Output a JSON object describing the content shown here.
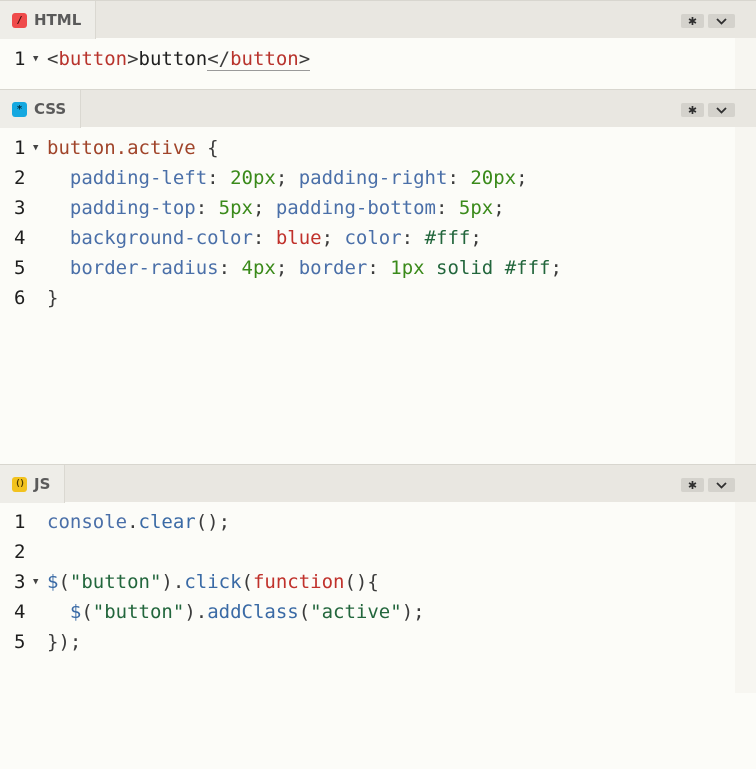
{
  "panes": {
    "html": {
      "label": "HTML",
      "icon": "html-slash-icon",
      "lines": [
        {
          "n": "1",
          "fold": true,
          "tokens": [
            {
              "t": "<",
              "c": "punc"
            },
            {
              "t": "button",
              "c": "tag"
            },
            {
              "t": ">",
              "c": "punc"
            },
            {
              "t": "button",
              "c": "text"
            },
            {
              "t": "</",
              "c": "punc",
              "u": true
            },
            {
              "t": "button",
              "c": "tag",
              "u": true
            },
            {
              "t": ">",
              "c": "punc",
              "u": true
            }
          ]
        }
      ]
    },
    "css": {
      "label": "CSS",
      "icon": "css-asterisk-icon",
      "lines": [
        {
          "n": "1",
          "fold": true,
          "tokens": [
            {
              "t": "button.active",
              "c": "sel"
            },
            {
              "t": " {",
              "c": "punc"
            }
          ]
        },
        {
          "n": "2",
          "tokens": [
            {
              "t": "  ",
              "c": "punc"
            },
            {
              "t": "padding-left",
              "c": "prop"
            },
            {
              "t": ": ",
              "c": "punc"
            },
            {
              "t": "20px",
              "c": "num"
            },
            {
              "t": "; ",
              "c": "punc"
            },
            {
              "t": "padding-right",
              "c": "prop"
            },
            {
              "t": ": ",
              "c": "punc"
            },
            {
              "t": "20px",
              "c": "num"
            },
            {
              "t": ";",
              "c": "punc"
            }
          ]
        },
        {
          "n": "3",
          "tokens": [
            {
              "t": "  ",
              "c": "punc"
            },
            {
              "t": "padding-top",
              "c": "prop"
            },
            {
              "t": ": ",
              "c": "punc"
            },
            {
              "t": "5px",
              "c": "num"
            },
            {
              "t": "; ",
              "c": "punc"
            },
            {
              "t": "padding-bottom",
              "c": "prop"
            },
            {
              "t": ": ",
              "c": "punc"
            },
            {
              "t": "5px",
              "c": "num"
            },
            {
              "t": ";",
              "c": "punc"
            }
          ]
        },
        {
          "n": "4",
          "tokens": [
            {
              "t": "  ",
              "c": "punc"
            },
            {
              "t": "background-color",
              "c": "prop"
            },
            {
              "t": ": ",
              "c": "punc"
            },
            {
              "t": "blue",
              "c": "kw"
            },
            {
              "t": "; ",
              "c": "punc"
            },
            {
              "t": "color",
              "c": "prop"
            },
            {
              "t": ": ",
              "c": "punc"
            },
            {
              "t": "#fff",
              "c": "val"
            },
            {
              "t": ";",
              "c": "punc"
            }
          ]
        },
        {
          "n": "5",
          "tokens": [
            {
              "t": "  ",
              "c": "punc"
            },
            {
              "t": "border-radius",
              "c": "prop"
            },
            {
              "t": ": ",
              "c": "punc"
            },
            {
              "t": "4px",
              "c": "num"
            },
            {
              "t": "; ",
              "c": "punc"
            },
            {
              "t": "border",
              "c": "prop"
            },
            {
              "t": ": ",
              "c": "punc"
            },
            {
              "t": "1px",
              "c": "num"
            },
            {
              "t": " ",
              "c": "punc"
            },
            {
              "t": "solid",
              "c": "val"
            },
            {
              "t": " ",
              "c": "punc"
            },
            {
              "t": "#fff",
              "c": "val"
            },
            {
              "t": ";",
              "c": "punc"
            }
          ]
        },
        {
          "n": "6",
          "tokens": [
            {
              "t": "}",
              "c": "punc"
            }
          ]
        }
      ]
    },
    "js": {
      "label": "JS",
      "icon": "js-parens-icon",
      "lines": [
        {
          "n": "1",
          "tokens": [
            {
              "t": "console",
              "c": "prop"
            },
            {
              "t": ".",
              "c": "punc"
            },
            {
              "t": "clear",
              "c": "fn"
            },
            {
              "t": "();",
              "c": "punc"
            }
          ]
        },
        {
          "n": "2",
          "tokens": []
        },
        {
          "n": "3",
          "fold": true,
          "tokens": [
            {
              "t": "$",
              "c": "fn"
            },
            {
              "t": "(",
              "c": "punc"
            },
            {
              "t": "\"button\"",
              "c": "str"
            },
            {
              "t": ").",
              "c": "punc"
            },
            {
              "t": "click",
              "c": "fn"
            },
            {
              "t": "(",
              "c": "punc"
            },
            {
              "t": "function",
              "c": "kw"
            },
            {
              "t": "(){",
              "c": "punc"
            }
          ]
        },
        {
          "n": "4",
          "tokens": [
            {
              "t": "  ",
              "c": "punc"
            },
            {
              "t": "$",
              "c": "fn"
            },
            {
              "t": "(",
              "c": "punc"
            },
            {
              "t": "\"button\"",
              "c": "str"
            },
            {
              "t": ").",
              "c": "punc"
            },
            {
              "t": "addClass",
              "c": "fn"
            },
            {
              "t": "(",
              "c": "punc"
            },
            {
              "t": "\"active\"",
              "c": "str"
            },
            {
              "t": ");",
              "c": "punc"
            }
          ]
        },
        {
          "n": "5",
          "tokens": [
            {
              "t": "});",
              "c": "punc"
            }
          ]
        }
      ]
    }
  },
  "header_buttons": {
    "settings_icon": "gear-icon",
    "collapse_icon": "chevron-down-icon"
  },
  "colors": {
    "background": "#fcfcf8",
    "header": "#e9e7e1",
    "tag": "#b8332c",
    "property": "#4a6fa8",
    "number": "#3a8a1a",
    "keyword": "#c0312b",
    "string": "#22663c"
  }
}
